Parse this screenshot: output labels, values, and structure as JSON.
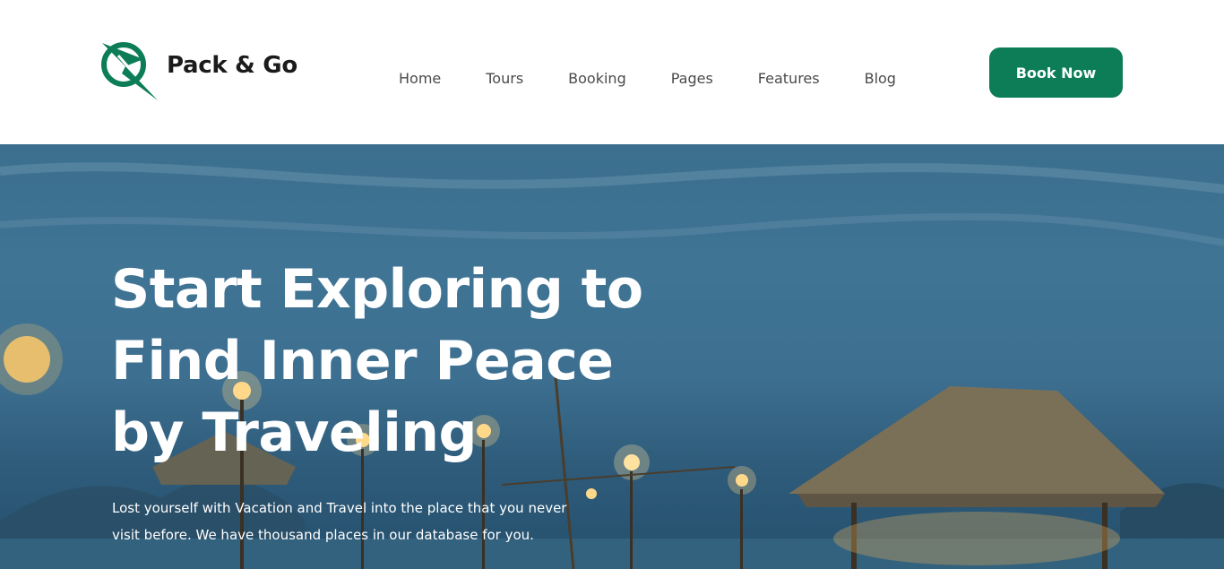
{
  "brand": {
    "name": "Pack & Go",
    "accent_color": "#0c7d57",
    "logo_icon": "compass-plane-logo-icon"
  },
  "nav": {
    "items": [
      {
        "label": "Home"
      },
      {
        "label": "Tours"
      },
      {
        "label": "Booking"
      },
      {
        "label": "Pages"
      },
      {
        "label": "Features"
      },
      {
        "label": "Blog"
      }
    ]
  },
  "header": {
    "cta_label": "Book Now"
  },
  "hero": {
    "title_lines": [
      "Start Exploring to",
      "Find Inner Peace",
      "by Traveling"
    ],
    "subtitle": "Lost yourself with Vacation and Travel into the place that you never visit before. We have thousand places in our database for you."
  }
}
